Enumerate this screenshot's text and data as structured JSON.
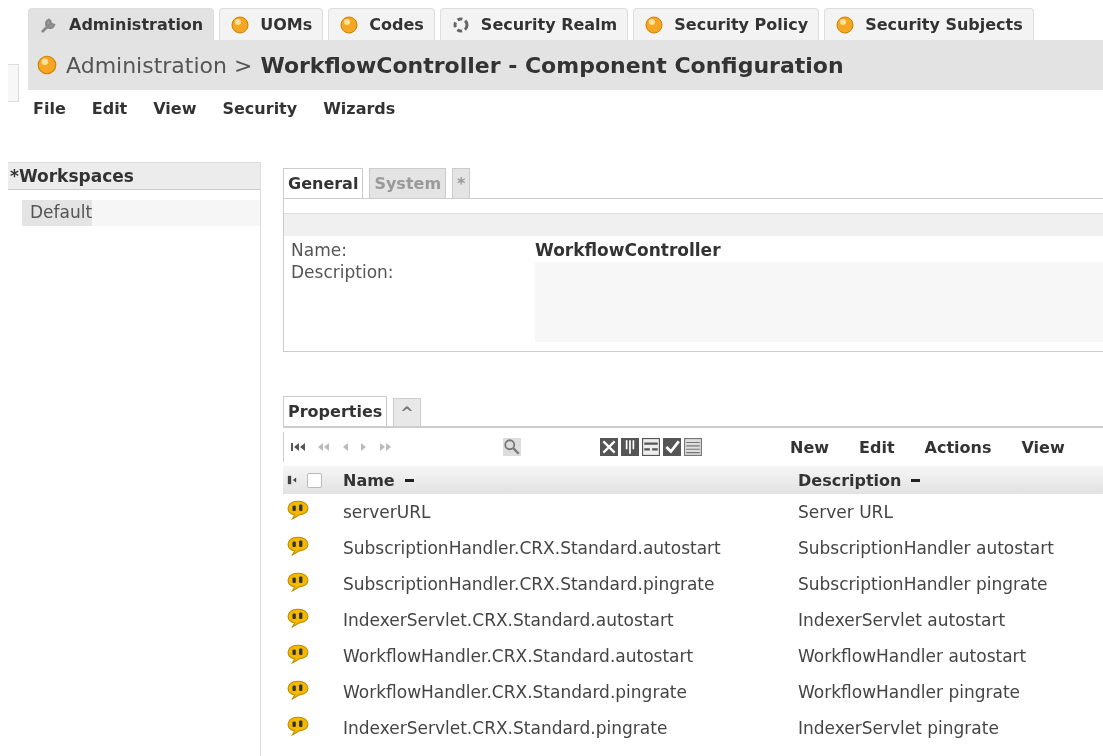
{
  "app_tabs": [
    {
      "label": "Administration",
      "kind": "tool",
      "selected": true
    },
    {
      "label": "UOMs",
      "kind": "module",
      "selected": false
    },
    {
      "label": "Codes",
      "kind": "module",
      "selected": false
    },
    {
      "label": "Security Realm",
      "kind": "service",
      "selected": false
    },
    {
      "label": "Security Policy",
      "kind": "module",
      "selected": false
    },
    {
      "label": "Security Subjects",
      "kind": "module",
      "selected": false
    }
  ],
  "title": {
    "path": "Administration >",
    "name": "WorkflowController - Component Configuration"
  },
  "menu": [
    "File",
    "Edit",
    "View",
    "Security",
    "Wizards"
  ],
  "sidebar": {
    "title": "*Workspaces",
    "items": [
      {
        "label": "Default",
        "selected": true
      }
    ]
  },
  "detail_tabs": [
    {
      "label": "General",
      "selected": true
    },
    {
      "label": "System",
      "selected": false
    },
    {
      "label": "*",
      "selected": false
    }
  ],
  "form": {
    "name_label": "Name:",
    "name_value": "WorkflowController",
    "description_label": "Description:"
  },
  "properties": {
    "tab": "Properties",
    "collapse": "^",
    "actions": [
      "New",
      "Edit",
      "Actions",
      "View"
    ],
    "columns": [
      "Name",
      "Description"
    ],
    "select_all": {
      "checked": false
    },
    "rows": [
      {
        "name": "serverURL",
        "description": "Server URL"
      },
      {
        "name": "SubscriptionHandler.CRX.Standard.autostart",
        "description": "SubscriptionHandler autostart"
      },
      {
        "name": "SubscriptionHandler.CRX.Standard.pingrate",
        "description": "SubscriptionHandler pingrate"
      },
      {
        "name": "IndexerServlet.CRX.Standard.autostart",
        "description": "IndexerServlet autostart"
      },
      {
        "name": "WorkflowHandler.CRX.Standard.autostart",
        "description": "WorkflowHandler autostart"
      },
      {
        "name": "WorkflowHandler.CRX.Standard.pingrate",
        "description": "WorkflowHandler pingrate"
      },
      {
        "name": "IndexerServlet.CRX.Standard.pingrate",
        "description": "IndexerServlet pingrate"
      }
    ]
  }
}
